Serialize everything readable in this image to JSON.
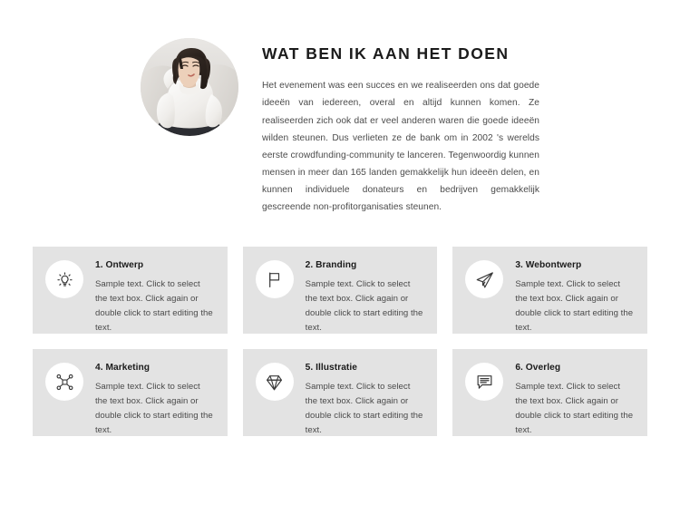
{
  "hero": {
    "photo_alt": "portrait-photo-woman-white-sweater",
    "title": "WAT BEN IK AAN HET DOEN",
    "body": "Het evenement was een succes en we realiseerden ons dat goede ideeën van iedereen, overal en altijd kunnen komen. Ze realiseerden zich ook dat er veel anderen waren die goede ideeën wilden steunen. Dus verlieten ze de bank om in 2002 's werelds eerste crowdfunding-community te lanceren. Tegenwoordig kunnen mensen in meer dan 165 landen gemakkelijk hun ideeën delen, en kunnen individuele donateurs en bedrijven gemakkelijk gescreende non-profitorganisaties steunen."
  },
  "cards": [
    {
      "icon": "lightbulb-icon",
      "title": "1. Ontwerp",
      "text": "Sample text. Click to select the text box. Click again or double click to start editing the text."
    },
    {
      "icon": "flag-icon",
      "title": "2. Branding",
      "text": "Sample text. Click to select the text box. Click again or double click to start editing the text."
    },
    {
      "icon": "paper-plane-icon",
      "title": "3. Webontwerp",
      "text": "Sample text. Click to select the text box. Click again or double click to start editing the text."
    },
    {
      "icon": "network-nodes-icon",
      "title": "4. Marketing",
      "text": "Sample text. Click to select the text box. Click again or double click to start editing the text."
    },
    {
      "icon": "diamond-icon",
      "title": "5. Illustratie",
      "text": "Sample text. Click to select the text box. Click again or double click to start editing the text."
    },
    {
      "icon": "speech-bubble-icon",
      "title": "6. Overleg",
      "text": "Sample text. Click to select the text box. Click again or double click to start editing the text."
    }
  ],
  "colors": {
    "page_background": "#ffffff",
    "card_background": "#e3e3e3",
    "icon_circle": "#ffffff",
    "heading_text": "#1b1b1b",
    "body_text": "#4b4b4b",
    "icon_stroke": "#3a3a3a"
  }
}
